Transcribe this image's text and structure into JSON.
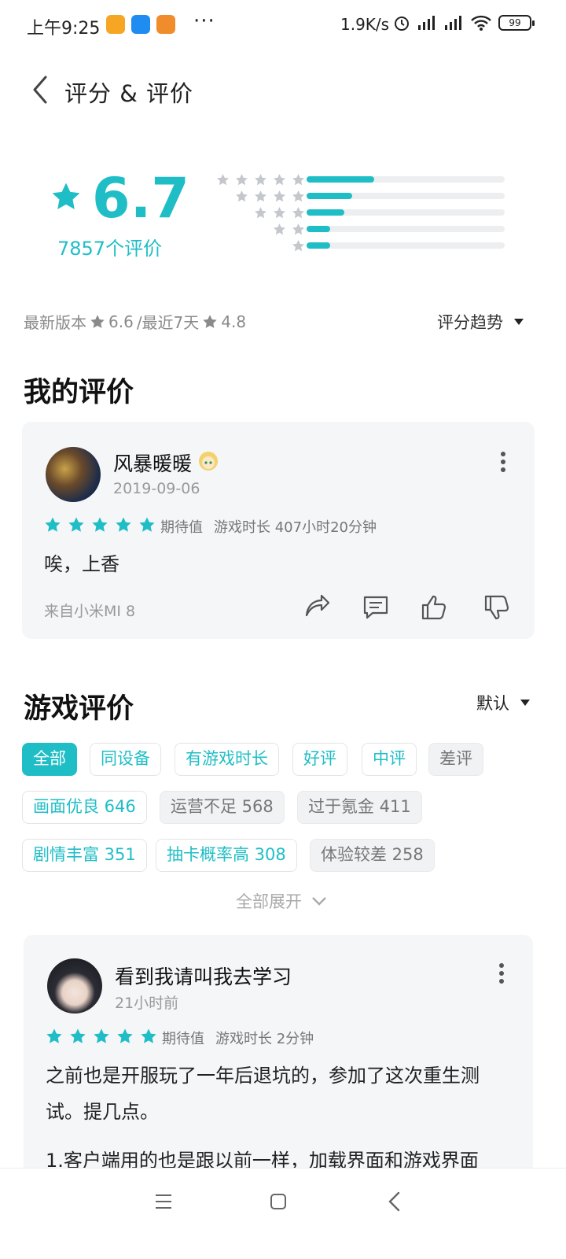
{
  "status_bar": {
    "time": "上午9:25",
    "more": "···",
    "net_speed": "1.9K/s",
    "signal1": "HD",
    "signal2": "HD",
    "battery": "99"
  },
  "header": {
    "title": "评分 & 评价"
  },
  "rating": {
    "score": "6.7",
    "count": "7857个评价",
    "distribution": [
      {
        "stars": 5,
        "fraction": 0.34
      },
      {
        "stars": 4,
        "fraction": 0.23
      },
      {
        "stars": 3,
        "fraction": 0.19
      },
      {
        "stars": 2,
        "fraction": 0.12
      },
      {
        "stars": 1,
        "fraction": 0.12
      }
    ]
  },
  "version_line": {
    "latest_label": "最新版本",
    "latest_score": "6.6",
    "recent_label": "/最近7天",
    "recent_score": "4.8",
    "trend_label": "评分趋势"
  },
  "my_review": {
    "section_title": "我的评价",
    "user": "风暴暖暖",
    "date": "2019-09-06",
    "stars": 5,
    "expectation": "期待值",
    "playtime": "游戏时长 407小时20分钟",
    "text": "唉，上香",
    "device": "来自小米MI 8"
  },
  "game_reviews": {
    "section_title": "游戏评价",
    "sort_label": "默认",
    "filters": [
      {
        "label": "全部",
        "style": "active"
      },
      {
        "label": "同设备",
        "style": "normal"
      },
      {
        "label": "有游戏时长",
        "style": "normal"
      },
      {
        "label": "好评",
        "style": "normal"
      },
      {
        "label": "中评",
        "style": "normal"
      },
      {
        "label": "差评",
        "style": "gray"
      },
      {
        "label": "画面优良 646",
        "style": "normal"
      },
      {
        "label": "运营不足 568",
        "style": "gray"
      },
      {
        "label": "过于氪金 411",
        "style": "gray"
      },
      {
        "label": "剧情丰富 351",
        "style": "normal"
      },
      {
        "label": "抽卡概率高 308",
        "style": "normal"
      },
      {
        "label": "体验较差 258",
        "style": "gray"
      }
    ],
    "expand_label": "全部展开"
  },
  "review": {
    "user": "看到我请叫我去学习",
    "time": "21小时前",
    "stars": 5,
    "expectation": "期待值",
    "playtime": "游戏时长 2分钟",
    "text_line1": "之前也是开服玩了一年后退坑的，参加了这次重生测",
    "text_line2": "试。提几点。",
    "text_line3": "1.客户端用的也是跟以前一样，加载界面和游戏界面"
  },
  "colors": {
    "accent": "#1fbec6",
    "card_bg": "#f5f6f8",
    "muted": "#999999"
  }
}
